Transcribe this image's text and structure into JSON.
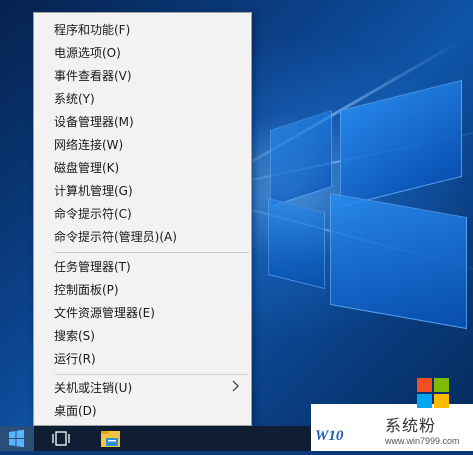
{
  "context_menu": {
    "items": [
      {
        "label": "程序和功能(F)"
      },
      {
        "label": "电源选项(O)"
      },
      {
        "label": "事件查看器(V)"
      },
      {
        "label": "系统(Y)"
      },
      {
        "label": "设备管理器(M)"
      },
      {
        "label": "网络连接(W)"
      },
      {
        "label": "磁盘管理(K)"
      },
      {
        "label": "计算机管理(G)"
      },
      {
        "label": "命令提示符(C)"
      },
      {
        "label": "命令提示符(管理员)(A)"
      },
      {
        "label": "任务管理器(T)"
      },
      {
        "label": "控制面板(P)"
      },
      {
        "label": "文件资源管理器(E)"
      },
      {
        "label": "搜索(S)"
      },
      {
        "label": "运行(R)"
      },
      {
        "label": "关机或注销(U)"
      },
      {
        "label": "桌面(D)"
      }
    ]
  },
  "taskbar": {
    "start_icon": "windows-logo-icon",
    "task_view_icon": "task-view-icon",
    "explorer_icon": "file-explorer-icon"
  },
  "watermark": {
    "brand": "系统粉",
    "url": "www.win7999.com",
    "os_text": "W10"
  },
  "colors": {
    "menu_bg": "#f2f2f2",
    "taskbar_bg": "#0f1e33",
    "desktop_accent": "#0f55a8"
  }
}
